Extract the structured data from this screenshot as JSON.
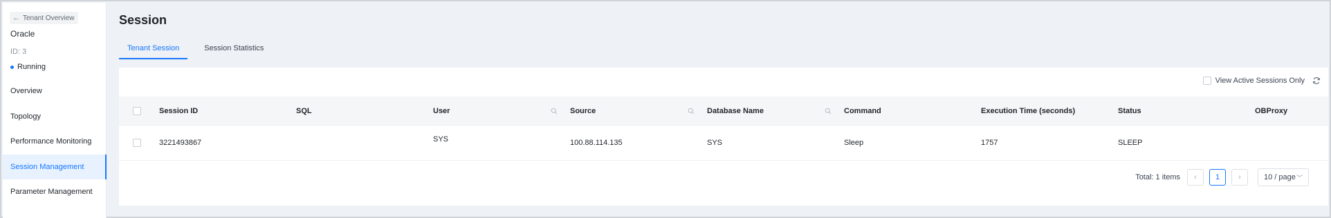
{
  "sidebar": {
    "back_label": "Tenant Overview",
    "tenant_name": "Oracle",
    "tenant_id": "ID: 3",
    "tenant_status": "Running",
    "items": [
      {
        "label": "Overview"
      },
      {
        "label": "Topology"
      },
      {
        "label": "Performance Monitoring"
      },
      {
        "label": "Session Management"
      },
      {
        "label": "Parameter Management"
      }
    ]
  },
  "page": {
    "title": "Session",
    "tabs": [
      {
        "label": "Tenant Session"
      },
      {
        "label": "Session Statistics"
      }
    ]
  },
  "toolbar": {
    "view_active_label": "View Active Sessions Only"
  },
  "table": {
    "columns": [
      "Session ID",
      "SQL",
      "User",
      "Source",
      "Database Name",
      "Command",
      "Execution Time (seconds)",
      "Status",
      "OBProxy"
    ],
    "rows": [
      {
        "session_id": "3221493867",
        "sql": "",
        "user": "SYS",
        "source": "100.88.114.135",
        "database": "SYS",
        "command": "Sleep",
        "exec_time": "1757",
        "status": "SLEEP",
        "obproxy": ""
      }
    ]
  },
  "pagination": {
    "total_label": "Total: 1 items",
    "current_page": "1",
    "page_size": "10 / page"
  },
  "colors": {
    "accent": "#1677ff",
    "active_bg": "#e8f2ff"
  }
}
